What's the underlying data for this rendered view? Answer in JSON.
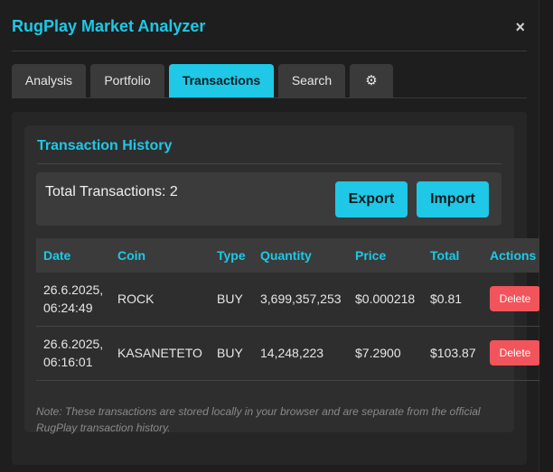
{
  "header": {
    "title": "RugPlay Market Analyzer",
    "close_symbol": "×"
  },
  "tabs": [
    {
      "label": "Analysis"
    },
    {
      "label": "Portfolio"
    },
    {
      "label": "Transactions"
    },
    {
      "label": "Search"
    },
    {
      "icon": "gear-icon",
      "glyph": "⚙"
    }
  ],
  "active_tab": "Transactions",
  "transactions": {
    "title": "Transaction History",
    "total_label": "Total Transactions: 2",
    "export_label": "Export",
    "import_label": "Import",
    "columns": [
      "Date",
      "Coin",
      "Type",
      "Quantity",
      "Price",
      "Total",
      "Actions"
    ],
    "rows": [
      {
        "date": "26.6.2025,",
        "time": "06:24:49",
        "coin": "ROCK",
        "type": "BUY",
        "quantity": "3,699,357,253",
        "price": "$0.000218",
        "total": "$0.81",
        "action": "Delete"
      },
      {
        "date": "26.6.2025,",
        "time": "06:16:01",
        "coin": "KASANETETO",
        "type": "BUY",
        "quantity": "14,248,223",
        "price": "$7.2900",
        "total": "$103.87",
        "action": "Delete"
      }
    ],
    "note": "Note: These transactions are stored locally in your browser and are separate from the official RugPlay transaction history."
  },
  "colors": {
    "accent": "#1ec8e6",
    "danger": "#f2545b",
    "background": "#1e1e1e"
  }
}
